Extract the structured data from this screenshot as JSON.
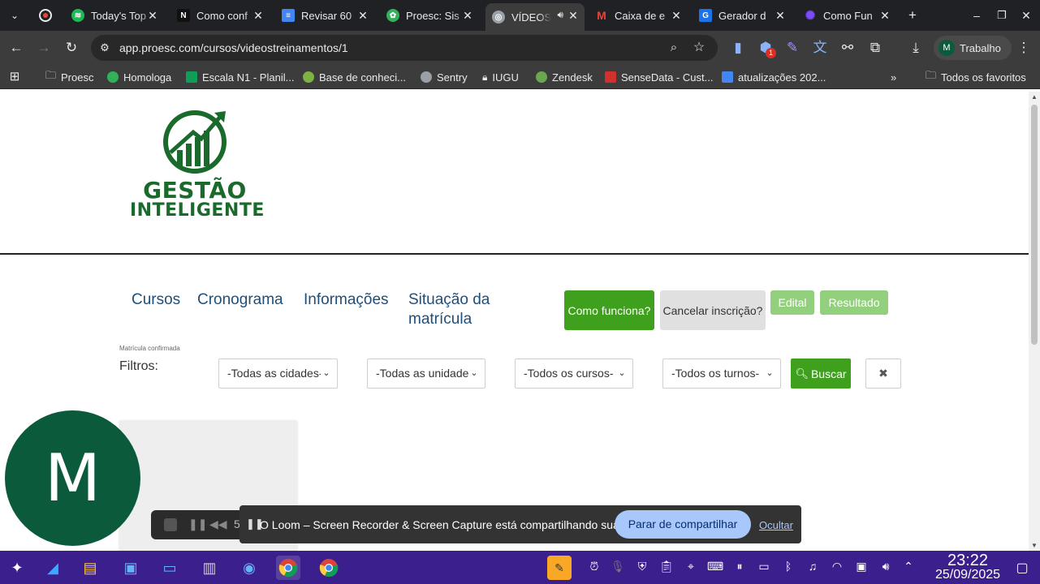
{
  "browser": {
    "tabs": [
      {
        "title": "",
        "favicon": "record-icon",
        "color": "#e8eaed"
      },
      {
        "title": "Today's Top",
        "favicon": "spotify-icon",
        "color": "#1db954"
      },
      {
        "title": "Como conf",
        "favicon": "notion-icon",
        "color": "#111111"
      },
      {
        "title": "Revisar 60",
        "favicon": "docs-icon",
        "color": "#4285f4"
      },
      {
        "title": "Proesc: Sis",
        "favicon": "proesc-icon",
        "color": "#33b15a"
      },
      {
        "title": "VÍDEOS",
        "favicon": "globe-icon",
        "color": "#9aa0a6",
        "active": true
      },
      {
        "title": "Caixa de e",
        "favicon": "gmail-icon",
        "color": "#ea4335"
      },
      {
        "title": "Gerador d",
        "favicon": "generator-icon",
        "color": "#1a73e8"
      },
      {
        "title": "Como Fun",
        "favicon": "star-burst-icon",
        "color": "#7c4dff"
      }
    ],
    "url": "app.proesc.com/cursos/videostreinamentos/1",
    "profile_initial": "M",
    "profile_name": "Trabalho",
    "extension_badge": "1",
    "bookmarks": [
      {
        "label": "Proesc",
        "icon": "folder-icon"
      },
      {
        "label": "Homologa",
        "icon": "proesc-icon"
      },
      {
        "label": "Escala N1 - Planil...",
        "icon": "sheets-icon"
      },
      {
        "label": "Base de conheci...",
        "icon": "knowledge-icon"
      },
      {
        "label": "Sentry",
        "icon": "globe-icon"
      },
      {
        "label": "IUGU",
        "icon": "lock-icon"
      },
      {
        "label": "Zendesk",
        "icon": "zendesk-icon"
      },
      {
        "label": "SenseData - Cust...",
        "icon": "sensedata-icon"
      },
      {
        "label": "atualizações 202...",
        "icon": "docs-icon"
      }
    ],
    "all_bookmarks": "Todos os favoritos"
  },
  "page": {
    "logo": {
      "line1": "GESTÃO",
      "line2": "INTELIGENTE",
      "color": "#1a6a2c"
    },
    "nav": [
      "Cursos",
      "Cronograma",
      "Informações",
      "Situação da matrícula"
    ],
    "buttons": {
      "como_funciona": "Como funciona?",
      "cancelar": "Cancelar inscrição?",
      "edital": "Edital",
      "resultado": "Resultado"
    },
    "matricula_status": "Matrícula confirmada",
    "filters": {
      "label": "Filtros:",
      "cidades": "-Todas as cidades-",
      "unidades": "-Todas as unidades-",
      "cursos": "-Todos os cursos-",
      "turnos": "-Todos os turnos-",
      "buscar": "Buscar",
      "clear": "✖"
    }
  },
  "loom": {
    "avatar_initial": "M",
    "counter": "5",
    "share_message": "O Loom – Screen Recorder & Screen Capture está compartilhando sua tela.",
    "stop_sharing": "Parar de compartilhar",
    "hide": "Ocultar"
  },
  "taskbar": {
    "time": "23:22",
    "date": "25/09/2025"
  }
}
